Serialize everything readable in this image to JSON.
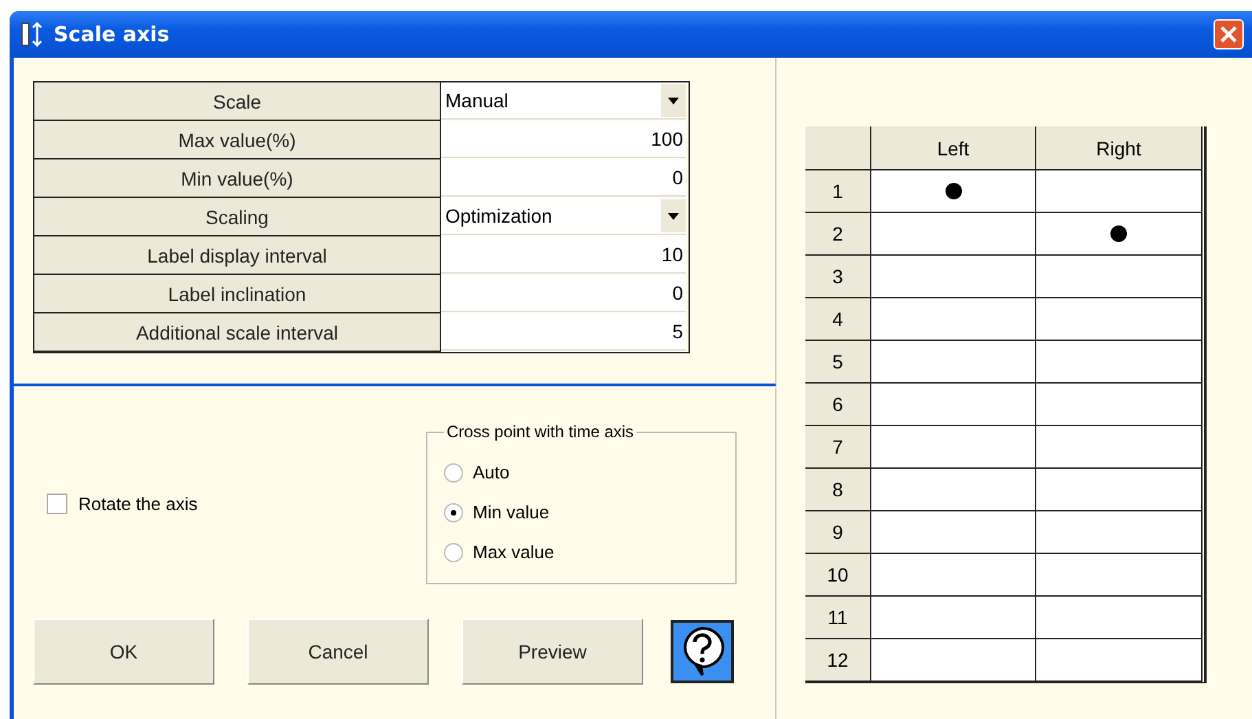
{
  "window": {
    "title": "Scale axis"
  },
  "settings": [
    {
      "label": "Scale",
      "kind": "dropdown",
      "value": "Manual"
    },
    {
      "label": "Max value(%)",
      "kind": "number",
      "value": "100"
    },
    {
      "label": "Min value(%)",
      "kind": "number",
      "value": "0"
    },
    {
      "label": "Scaling",
      "kind": "dropdown",
      "value": "Optimization"
    },
    {
      "label": "Label display interval",
      "kind": "number",
      "value": "10"
    },
    {
      "label": "Label inclination",
      "kind": "number",
      "value": "0"
    },
    {
      "label": "Additional scale interval",
      "kind": "number",
      "value": "5"
    }
  ],
  "rotate_axis": {
    "label": "Rotate the axis",
    "checked": false
  },
  "cross_point": {
    "title": "Cross point with time axis",
    "options": [
      {
        "label": "Auto",
        "selected": false
      },
      {
        "label": "Min value",
        "selected": true
      },
      {
        "label": "Max value",
        "selected": false
      }
    ]
  },
  "buttons": [
    "OK",
    "Cancel",
    "Preview"
  ],
  "axis_table": {
    "columns": [
      "Left",
      "Right"
    ],
    "rows": [
      {
        "number": "1",
        "left": true,
        "right": false
      },
      {
        "number": "2",
        "left": false,
        "right": true
      },
      {
        "number": "3",
        "left": false,
        "right": false
      },
      {
        "number": "4",
        "left": false,
        "right": false
      },
      {
        "number": "5",
        "left": false,
        "right": false
      },
      {
        "number": "6",
        "left": false,
        "right": false
      },
      {
        "number": "7",
        "left": false,
        "right": false
      },
      {
        "number": "8",
        "left": false,
        "right": false
      },
      {
        "number": "9",
        "left": false,
        "right": false
      },
      {
        "number": "10",
        "left": false,
        "right": false
      },
      {
        "number": "11",
        "left": false,
        "right": false
      },
      {
        "number": "12",
        "left": false,
        "right": false
      }
    ]
  }
}
